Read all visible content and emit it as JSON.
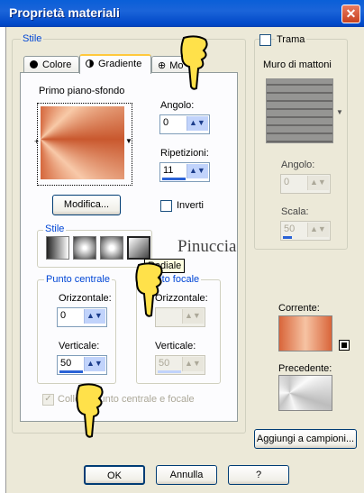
{
  "window": {
    "title": "Proprietà materiali",
    "close_glyph": "✕"
  },
  "stile_group": {
    "label": "Stile"
  },
  "tabs": [
    {
      "label": "Colore",
      "icon": "filled-circle-icon"
    },
    {
      "label": "Gradiente",
      "icon": "half-circle-icon"
    },
    {
      "label": "Mo",
      "icon": "crosshair-icon"
    }
  ],
  "active_tab": "Gradiente",
  "gradient_panel": {
    "preview_label": "Primo piano-sfondo",
    "edit_button": "Modifica...",
    "angle": {
      "label": "Angolo:",
      "value": "0"
    },
    "repetitions": {
      "label": "Ripetizioni:",
      "value": "11"
    },
    "invert": {
      "label": "Inverti",
      "checked": false
    },
    "style_label": "Stile",
    "style_tooltip": "Radiale",
    "center": {
      "label": "Punto centrale",
      "horizontal": {
        "label": "Orizzontale:",
        "value": "0"
      },
      "vertical": {
        "label": "Verticale:",
        "value": "50"
      }
    },
    "focal": {
      "label": "Punto focale",
      "horizontal": {
        "label": "Orizzontale:",
        "value": ""
      },
      "vertical": {
        "label": "Verticale:",
        "value": "50"
      }
    },
    "link_center_focal": {
      "label": "Collega punto centrale e focale",
      "checked": true
    }
  },
  "texture": {
    "label": "Trama",
    "checked": false,
    "name": "Muro di mattoni",
    "angle": {
      "label": "Angolo:",
      "value": "0"
    },
    "scale": {
      "label": "Scala:",
      "value": "50"
    }
  },
  "current_label": "Corrente:",
  "previous_label": "Precedente:",
  "add_to_swatches": "Aggiungi a campioni...",
  "buttons": {
    "ok": "OK",
    "cancel": "Annulla",
    "help": "?"
  },
  "watermark": "Pinuccia",
  "colors": {
    "title_bar": "#0a5fd8",
    "orange": "#d9653a",
    "peach": "#f6c3a3",
    "link_blue": "#0046d5"
  }
}
